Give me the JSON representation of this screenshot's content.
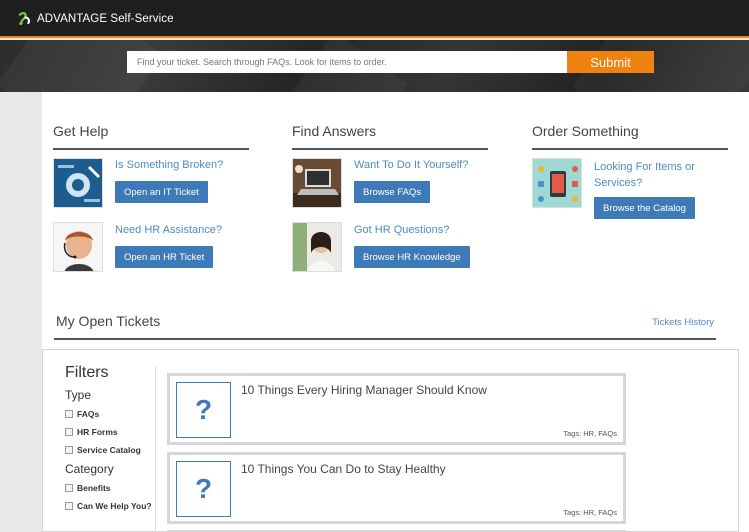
{
  "header": {
    "brand": "ADVANTAGE Self-Service",
    "brand_icon": "advantage-logo-icon",
    "accent": "#f0820f"
  },
  "search": {
    "placeholder": "Find your ticket. Search through FAQs. Look for items to order.",
    "submit_label": "Submit"
  },
  "sections": {
    "get_help": {
      "title": "Get Help",
      "items": [
        {
          "question": "Is Something Broken?",
          "button": "Open an IT Ticket",
          "icon": "it-support-thumbnail"
        },
        {
          "question": "Need HR Assistance?",
          "button": "Open an HR Ticket",
          "icon": "hr-support-thumbnail"
        }
      ]
    },
    "find_answers": {
      "title": "Find Answers",
      "items": [
        {
          "question": "Want To Do It Yourself?",
          "button": "Browse FAQs",
          "icon": "laptop-thumbnail"
        },
        {
          "question": "Got HR Questions?",
          "button": "Browse HR Knowledge",
          "icon": "hr-person-thumbnail"
        }
      ]
    },
    "order_something": {
      "title": "Order Something",
      "items": [
        {
          "question": "Looking For Items or Services?",
          "button": "Browse the Catalog",
          "icon": "catalog-thumbnail"
        }
      ]
    }
  },
  "tickets": {
    "title": "My Open Tickets",
    "history_link": "Tickets History"
  },
  "filters": {
    "title": "Filters",
    "groups": [
      {
        "label": "Type",
        "options": [
          "FAQs",
          "HR Forms",
          "Service Catalog"
        ]
      },
      {
        "label": "Category",
        "options": [
          "Benefits",
          "Can We Help You?"
        ]
      }
    ]
  },
  "cards": [
    {
      "title": "10 Things Every Hiring Manager Should Know",
      "tags": "Tags: HR, FAQs",
      "icon": "question-mark-icon"
    },
    {
      "title": "10 Things You Can Do to Stay Healthy",
      "tags": "Tags: HR, FAQs",
      "icon": "question-mark-icon"
    }
  ]
}
